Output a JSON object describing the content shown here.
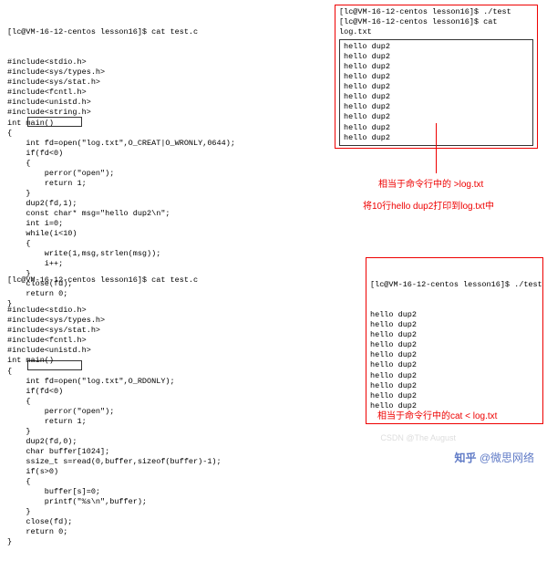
{
  "code1": {
    "prompt": "[lc@VM-16-12-centos lesson16]$ cat test.c",
    "lines": "#include<stdio.h>\n#include<sys/types.h>\n#include<sys/stat.h>\n#include<fcntl.h>\n#include<unistd.h>\n#include<string.h>\nint main()\n{\n    int fd=open(\"log.txt\",O_CREAT|O_WRONLY,0644);\n    if(fd<0)\n    {\n        perror(\"open\");\n        return 1;\n    }\n    dup2(fd,1);\n    const char* msg=\"hello dup2\\n\";\n    int i=0;\n    while(i<10)\n    {\n        write(1,msg,strlen(msg));\n        i++;\n    }\n    close(fd);\n    return 0;\n}"
  },
  "code2": {
    "prompt": "[lc@VM-16-12-centos lesson16]$ cat test.c",
    "lines": "#include<stdio.h>\n#include<sys/types.h>\n#include<sys/stat.h>\n#include<fcntl.h>\n#include<unistd.h>\nint main()\n{\n    int fd=open(\"log.txt\",O_RDONLY);\n    if(fd<0)\n    {\n        perror(\"open\");\n        return 1;\n    }\n    dup2(fd,0);\n    char buffer[1024];\n    ssize_t s=read(0,buffer,sizeof(buffer)-1);\n    if(s>0)\n    {\n        buffer[s]=0;\n        printf(\"%s\\n\",buffer);\n    }\n    close(fd);\n    return 0;\n}"
  },
  "output1": {
    "cmd_run": "[lc@VM-16-12-centos lesson16]$ ./test",
    "cmd_cat": "[lc@VM-16-12-centos lesson16]$ cat log.txt",
    "lines": "hello dup2\nhello dup2\nhello dup2\nhello dup2\nhello dup2\nhello dup2\nhello dup2\nhello dup2\nhello dup2\nhello dup2"
  },
  "output2": {
    "cmd_run": "[lc@VM-16-12-centos lesson16]$ ./test",
    "lines": "hello dup2\nhello dup2\nhello dup2\nhello dup2\nhello dup2\nhello dup2\nhello dup2\nhello dup2\nhello dup2\nhello dup2"
  },
  "annos": {
    "a1": "相当于命令行中的  >log.txt",
    "a2": "将10行hello dup2打印到log.txt中",
    "a3": "相当于命令行中的cat < log.txt"
  },
  "highlighted": {
    "h1": "dup2(fd,1);",
    "h2": "dup2(fd,0);"
  },
  "watermark": {
    "brand": "知乎",
    "user": "@微思网络",
    "csdn": "CSDN @The  August"
  }
}
